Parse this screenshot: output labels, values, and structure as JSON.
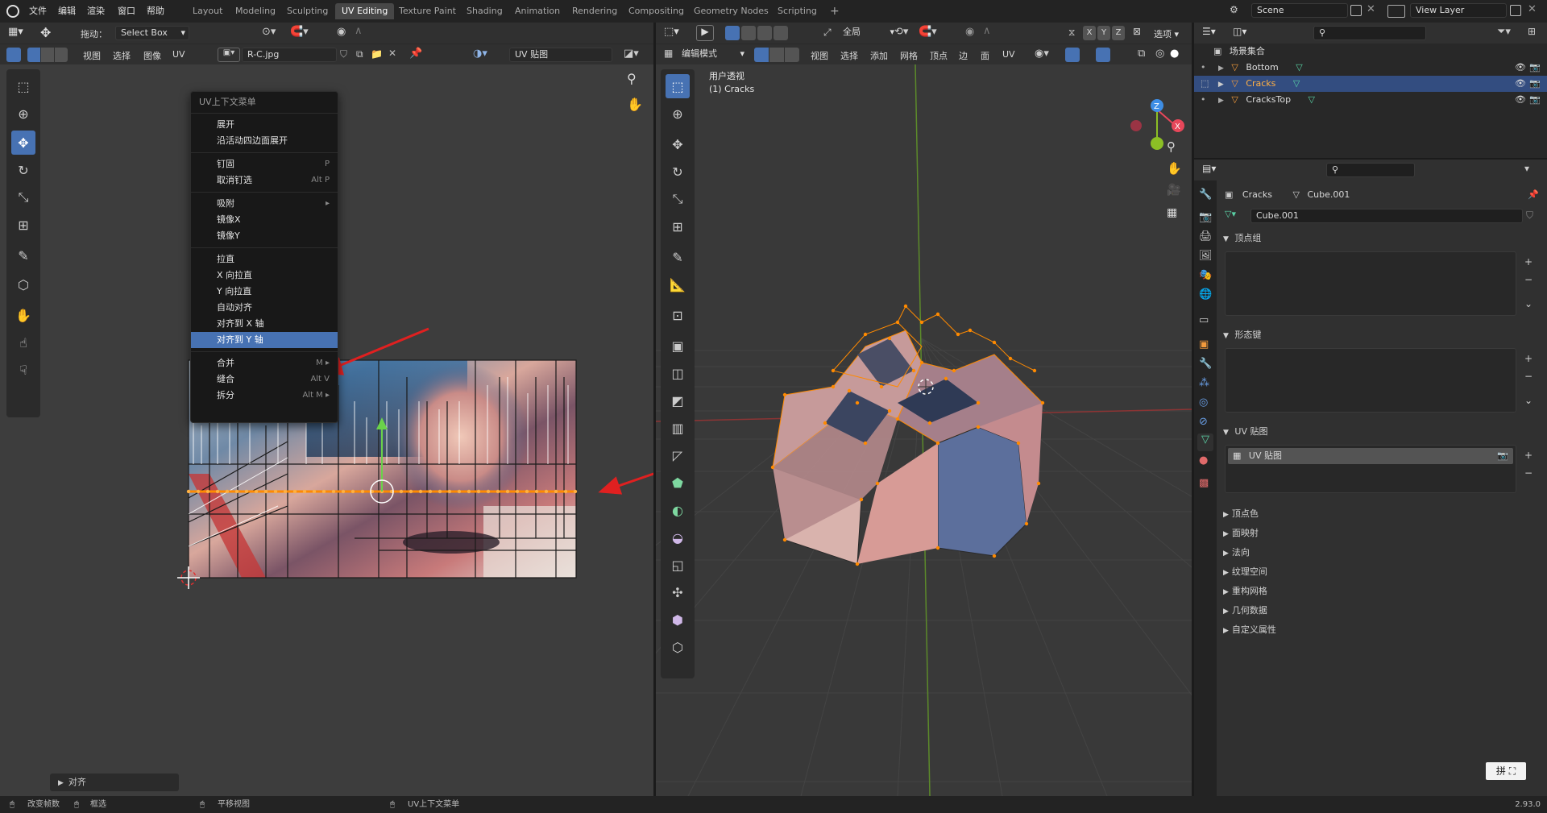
{
  "topbar": {
    "menus": [
      "文件",
      "编辑",
      "渲染",
      "窗口",
      "帮助"
    ],
    "tabs": [
      "Layout",
      "Modeling",
      "Sculpting",
      "UV Editing",
      "Texture Paint",
      "Shading",
      "Animation",
      "Rendering",
      "Compositing",
      "Geometry Nodes",
      "Scripting"
    ],
    "active_tab": "UV Editing",
    "add_tab": "+",
    "scene": "Scene",
    "view_layer": "View Layer"
  },
  "uv_editor": {
    "drag_label": "拖动：",
    "drag_value": "Select Box",
    "menus": [
      "视图",
      "选择",
      "图像",
      "UV"
    ],
    "image_name": "R-C.jpg",
    "uv_map_name": "UV 贴图",
    "context_menu": {
      "title": "UV上下文菜单",
      "groups": [
        [
          {
            "label": "展开",
            "shortcut": ""
          },
          {
            "label": "沿活动四边面展开",
            "shortcut": ""
          }
        ],
        [
          {
            "label": "钉固",
            "shortcut": "P"
          },
          {
            "label": "取消钉选",
            "shortcut": "Alt P"
          }
        ],
        [
          {
            "label": "吸附",
            "shortcut": "▸"
          },
          {
            "label": "镜像X",
            "shortcut": ""
          },
          {
            "label": "镜像Y",
            "shortcut": ""
          }
        ],
        [
          {
            "label": "拉直",
            "shortcut": ""
          },
          {
            "label": "X 向拉直",
            "shortcut": ""
          },
          {
            "label": "Y 向拉直",
            "shortcut": ""
          },
          {
            "label": "自动对齐",
            "shortcut": ""
          },
          {
            "label": "对齐到 X 轴",
            "shortcut": ""
          },
          {
            "label": "对齐到 Y 轴",
            "shortcut": ""
          }
        ],
        [
          {
            "label": "合并",
            "shortcut": "M ▸"
          },
          {
            "label": "缝合",
            "shortcut": "Alt V"
          },
          {
            "label": "拆分",
            "shortcut": "Alt M ▸"
          }
        ]
      ],
      "highlighted": "对齐到 Y 轴"
    },
    "last_op_panel": "对齐"
  },
  "viewport": {
    "mode": "编辑模式",
    "menus": [
      "视图",
      "选择",
      "添加",
      "网格",
      "顶点",
      "边",
      "面",
      "UV"
    ],
    "transform_orientation": "全局",
    "axes": [
      "X",
      "Y",
      "Z"
    ],
    "options": "选项",
    "view_name": "用户透视",
    "object_name": "(1) Cracks",
    "gizmo": {
      "x": "X",
      "y": "Y",
      "z": "Z",
      "x_color": "#e8475a",
      "y_color": "#8cbf25",
      "z_color": "#3e8ee5"
    }
  },
  "outliner": {
    "root": "场景集合",
    "items": [
      {
        "name": "Bottom",
        "selected": false
      },
      {
        "name": "Cracks",
        "selected": true
      },
      {
        "name": "CracksTop",
        "selected": false
      }
    ]
  },
  "properties": {
    "object": "Cracks",
    "mesh": "Cube.001",
    "mesh_field": "Cube.001",
    "panels_open": [
      "顶点组",
      "形态键",
      "UV 贴图"
    ],
    "uv_maps": [
      "UV 贴图"
    ],
    "panels_closed": [
      "顶点色",
      "面映射",
      "法向",
      "纹理空间",
      "重构网格",
      "几何数据",
      "自定义属性"
    ]
  },
  "statusbar": {
    "left": "改变帧数",
    "box": "框选",
    "pan": "平移视图",
    "ctx": "UV上下文菜单",
    "version": "2.93.0"
  },
  "colors": {
    "accent": "#4772b3",
    "selected_edge": "#ff8a00",
    "arrow": "#e02020"
  }
}
